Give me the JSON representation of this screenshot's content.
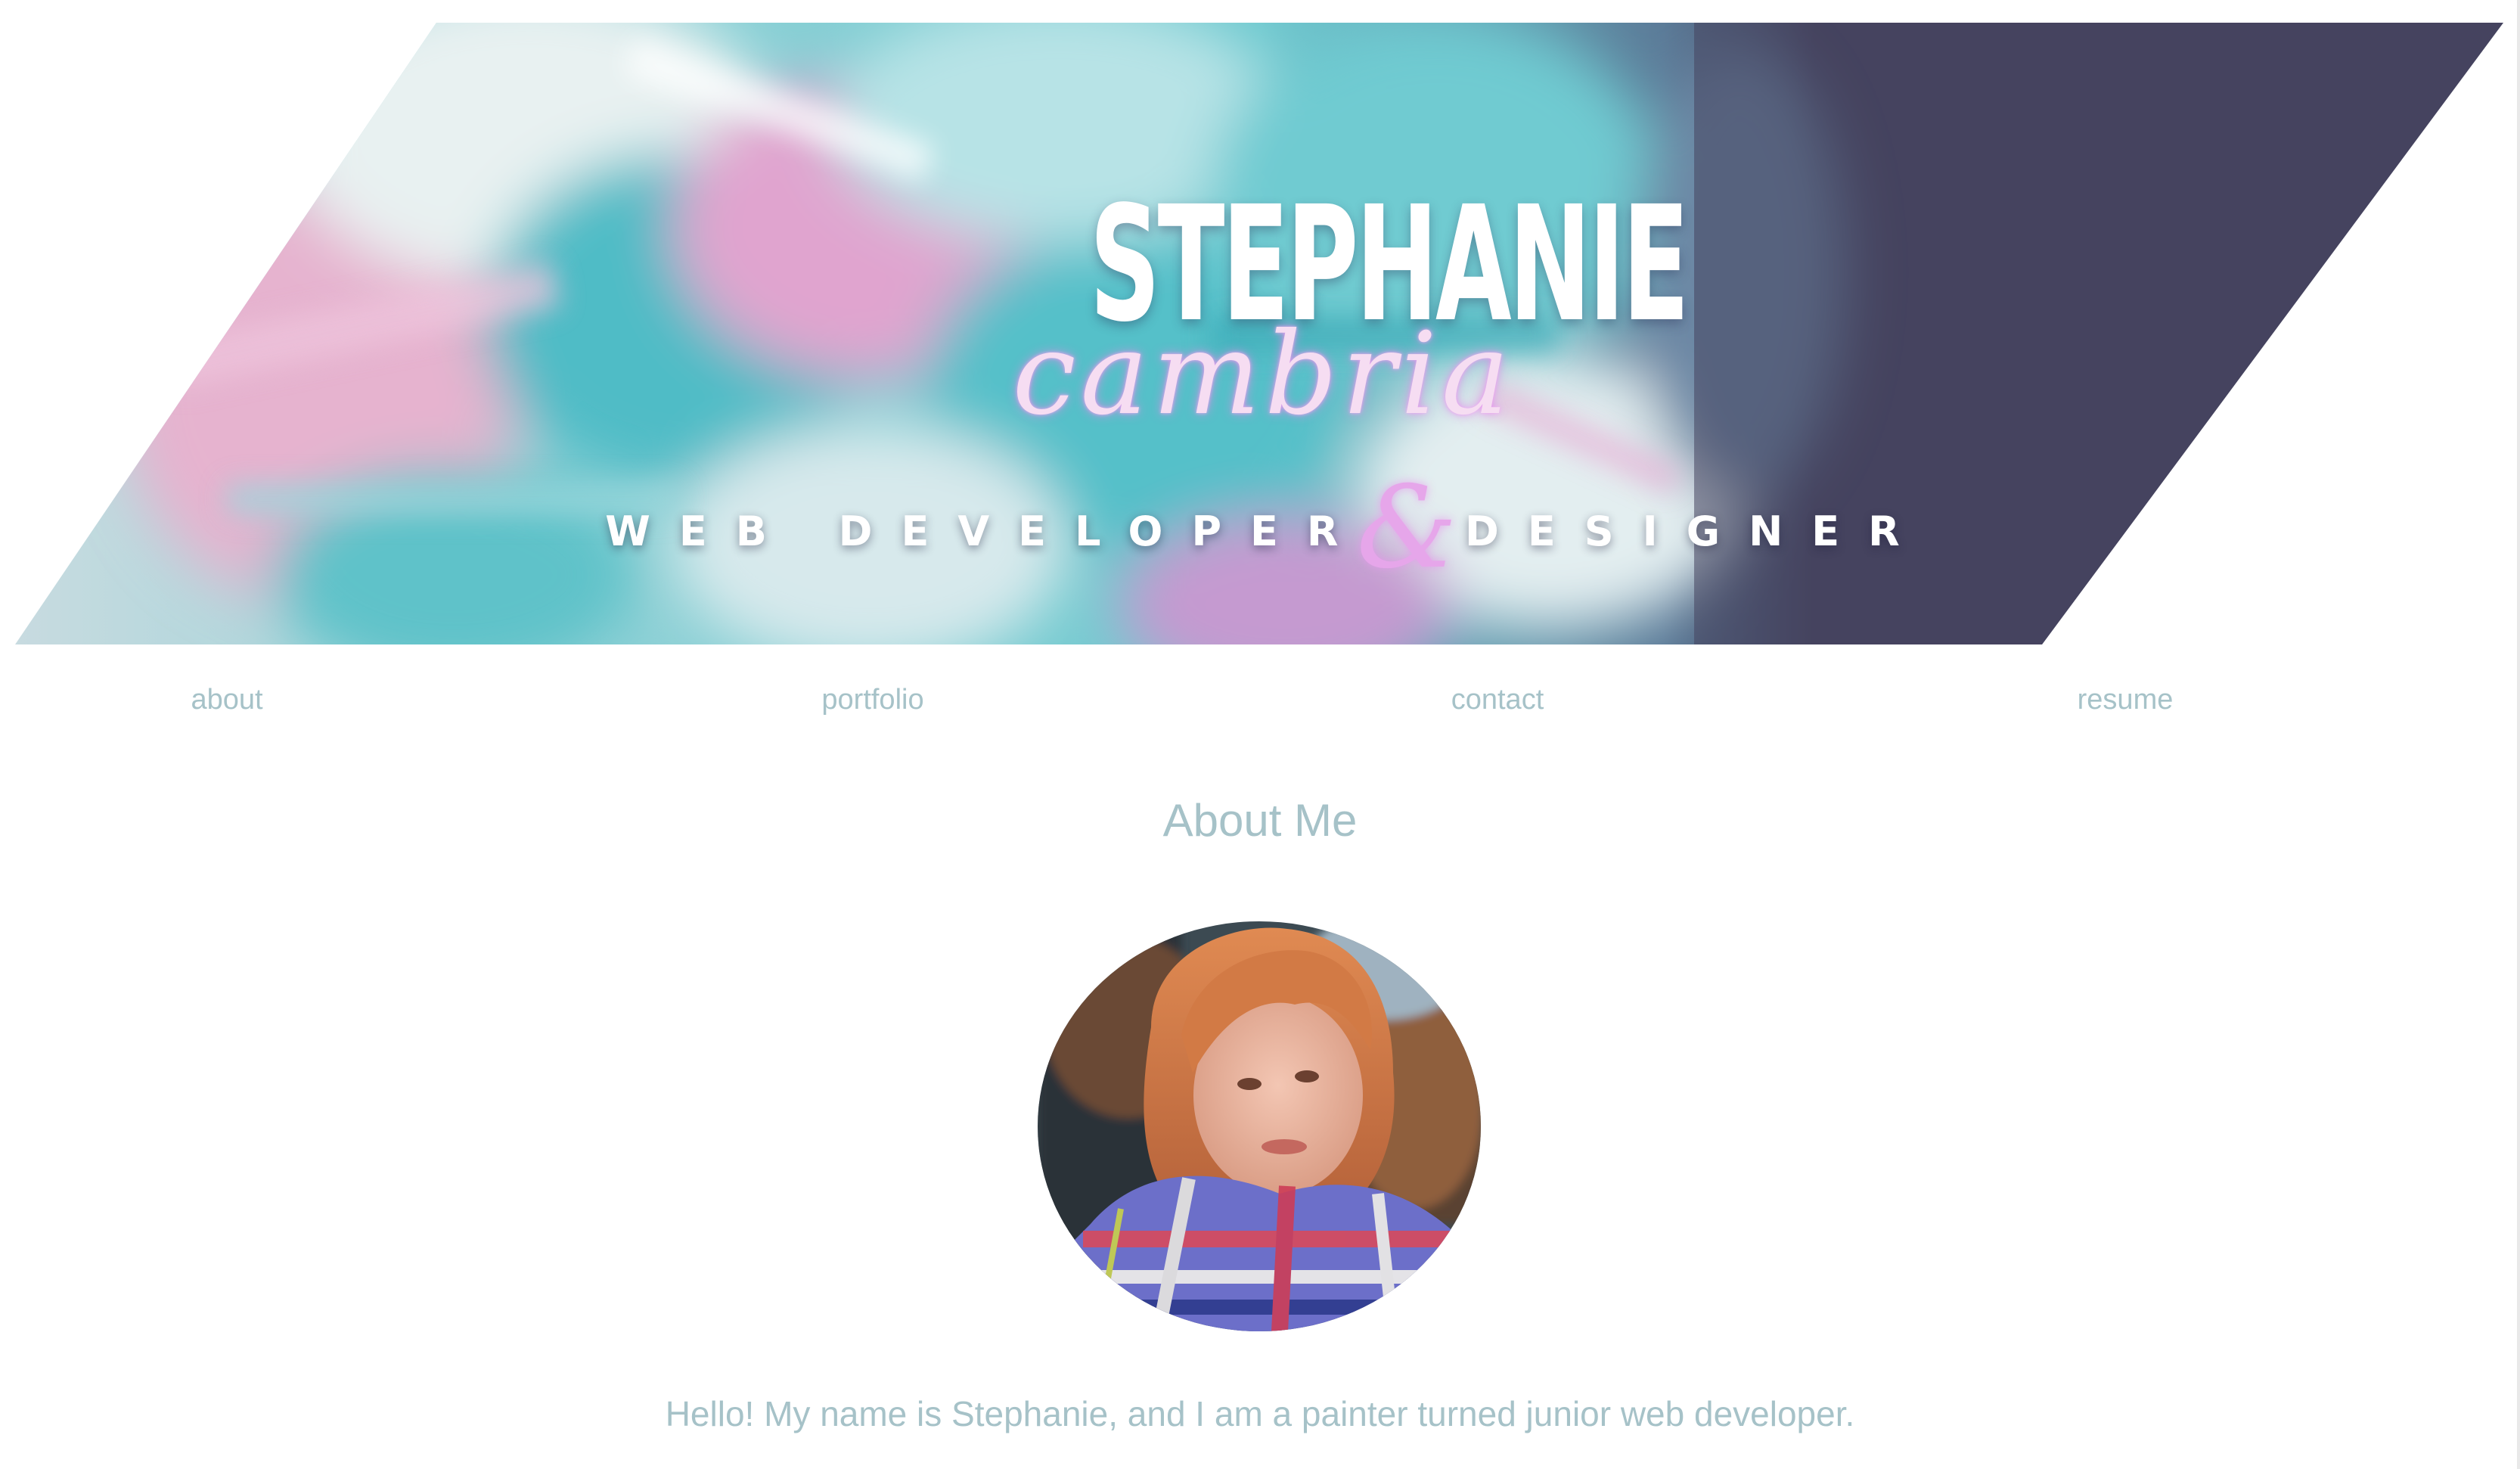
{
  "header": {
    "first_name": "STEPHANIE",
    "last_name": "cambria",
    "tagline_left": "WEB DEVELOPER",
    "tagline_amp": "&",
    "tagline_right": "DESIGNER"
  },
  "nav": {
    "items": [
      {
        "label": "about"
      },
      {
        "label": "portfolio"
      },
      {
        "label": "contact"
      },
      {
        "label": "resume"
      }
    ]
  },
  "about": {
    "title": "About Me",
    "intro": "Hello! My name is Stephanie, and I am a painter turned junior web developer."
  },
  "colors": {
    "accent_text": "#a6c2c8",
    "banner_dark": "#45435f",
    "banner_teal": "#5fc2c9",
    "banner_pink": "#e2a6cf"
  }
}
